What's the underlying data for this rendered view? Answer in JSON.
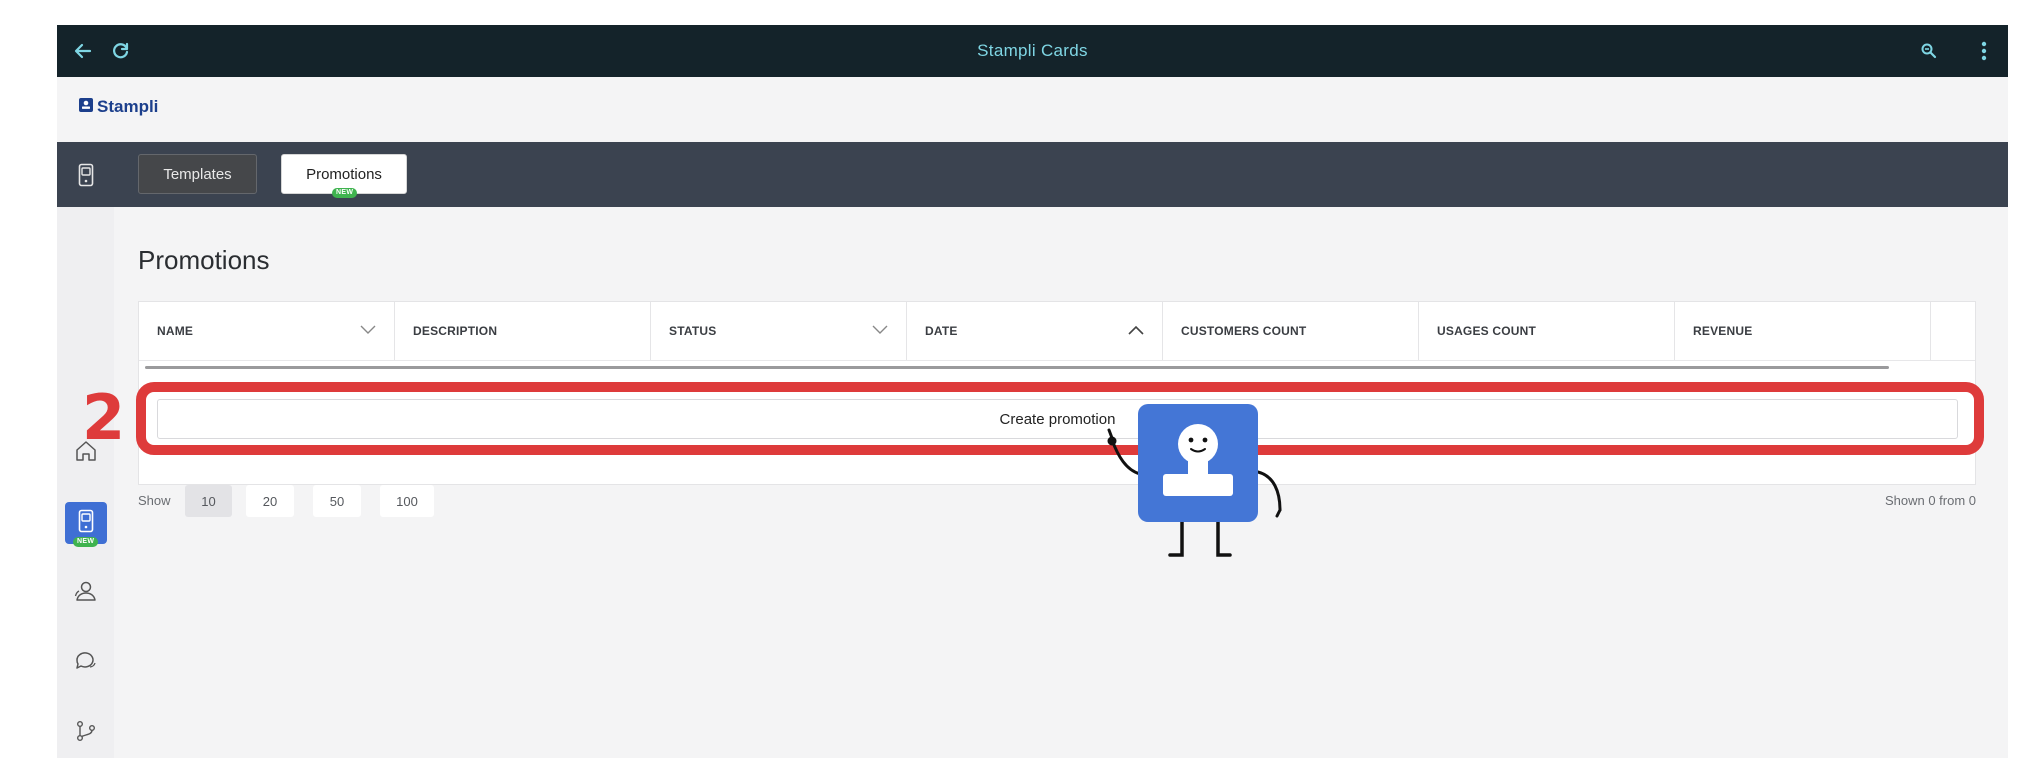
{
  "window": {
    "title": "Stampli Cards"
  },
  "topbar": {
    "back_icon": "arrow-left-icon",
    "refresh_icon": "refresh-icon",
    "zoom_icon": "zoom-icon",
    "menu_icon": "kebab-menu-icon"
  },
  "brand": {
    "name": "Stampli",
    "icon": "stamp-logo-icon"
  },
  "toolbar": {
    "tabs": [
      {
        "label": "Templates"
      },
      {
        "label": "Promotions",
        "badge": "NEW"
      }
    ]
  },
  "sidebar": {
    "items": [
      {
        "icon": "home-icon"
      },
      {
        "icon": "card-icon",
        "badge": "NEW",
        "active": true
      },
      {
        "icon": "customers-icon"
      },
      {
        "icon": "chat-icon"
      },
      {
        "icon": "integrations-icon"
      }
    ]
  },
  "main": {
    "title": "Promotions",
    "columns": [
      "NAME",
      "DESCRIPTION",
      "STATUS",
      "DATE",
      "CUSTOMERS COUNT",
      "USAGES COUNT",
      "REVENUE"
    ],
    "create_button": "Create promotion",
    "paging": {
      "show_label": "Show",
      "sizes": [
        "10",
        "20",
        "50",
        "100"
      ],
      "selected": "10",
      "summary": "Shown 0 from 0"
    }
  },
  "annotation": {
    "step": "2",
    "color": "#de3b3b"
  },
  "colors": {
    "topbar": "#14232a",
    "accent": "#7fd6e4",
    "toolbar": "#3b4350",
    "brand": "#1c3f8c",
    "active": "#3f6fd4",
    "badge": "#3fb34f"
  }
}
